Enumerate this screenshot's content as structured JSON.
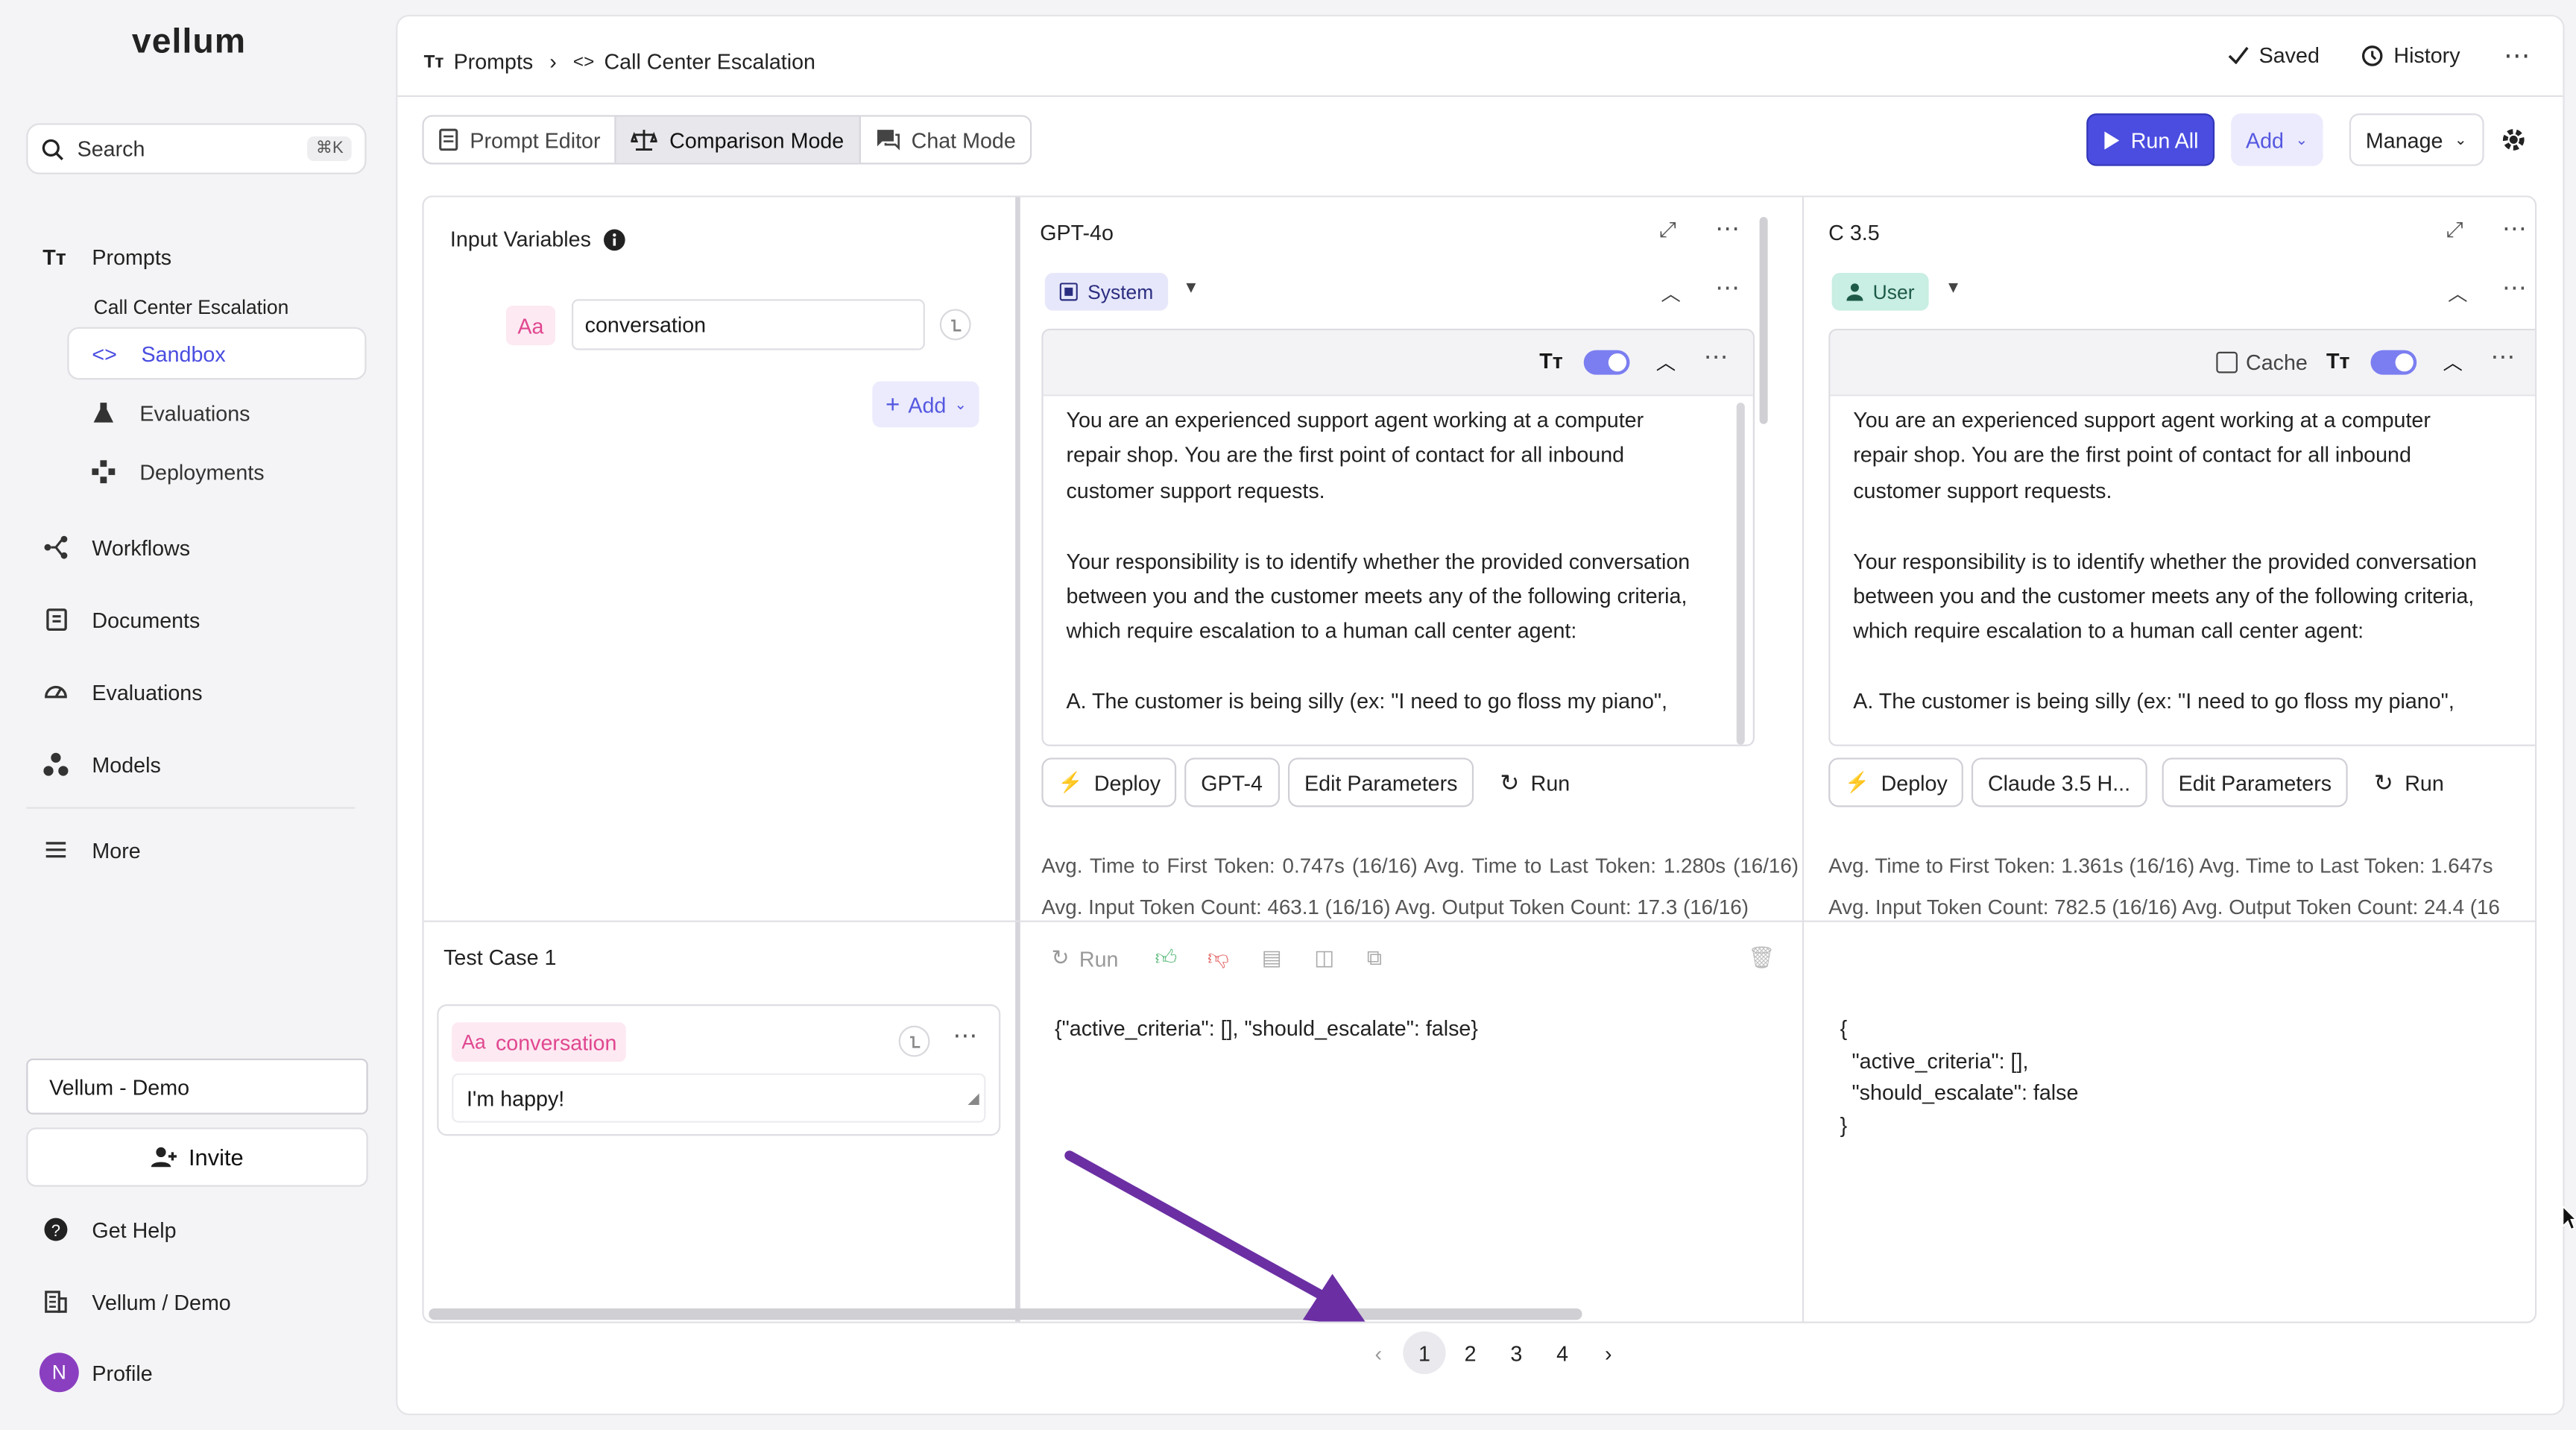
{
  "sidebar": {
    "logo": "vellum",
    "search": {
      "placeholder": "Search",
      "shortcut": "⌘K"
    },
    "items": [
      {
        "label": "Prompts",
        "icon": "text-tt-icon"
      },
      {
        "label": "Workflows",
        "icon": "workflow-icon"
      },
      {
        "label": "Documents",
        "icon": "documents-icon"
      },
      {
        "label": "Evaluations",
        "icon": "gauge-icon"
      },
      {
        "label": "Models",
        "icon": "models-icon"
      },
      {
        "label": "More",
        "icon": "list-icon"
      }
    ],
    "current_prompt": "Call Center Escalation",
    "subitems": [
      {
        "label": "Sandbox",
        "icon": "code-brackets-icon",
        "active": true
      },
      {
        "label": "Evaluations",
        "icon": "flask-icon"
      },
      {
        "label": "Deployments",
        "icon": "deploy-icon"
      }
    ],
    "workspace": "Vellum - Demo",
    "invite": "Invite",
    "footer": [
      {
        "label": "Get Help",
        "icon": "help-icon"
      },
      {
        "label": "Vellum / Demo",
        "icon": "building-icon"
      },
      {
        "label": "Profile",
        "avatar_letter": "N"
      }
    ]
  },
  "header": {
    "breadcrumb": [
      "Prompts",
      "Call Center Escalation"
    ],
    "saved": "Saved",
    "history": "History"
  },
  "toolbar": {
    "tabs": [
      "Prompt Editor",
      "Comparison Mode",
      "Chat Mode"
    ],
    "active_tab": "Comparison Mode",
    "run_all": "Run All",
    "add": "Add",
    "manage": "Manage"
  },
  "inputs": {
    "title": "Input Variables",
    "var_type": "Aa",
    "variable": "conversation",
    "add": "Add"
  },
  "prompt_text": "You are an experienced support agent working at a computer\nrepair shop. You are the first point of contact for all inbound\ncustomer support requests.\n\nYour responsibility is to identify whether the provided conversation\nbetween you and the customer meets any of the following criteria,\nwhich require escalation to a human call center agent:\n\nA. The customer is being silly (ex: \"I need to go floss my piano\",",
  "columns": [
    {
      "name": "GPT-4o",
      "role": "System",
      "model": "GPT-4",
      "deploy": "Deploy",
      "edit": "Edit Parameters",
      "run": "Run",
      "stats_line1": "Avg. Time to First Token: 0.747s (16/16)   Avg. Time to Last Token: 1.280s (16/16)",
      "stats_line2": "Avg. Input Token Count: 463.1 (16/16)   Avg. Output Token Count: 17.3 (16/16)",
      "output": "{\"active_criteria\": [], \"should_escalate\": false}"
    },
    {
      "name": "C 3.5",
      "role": "User",
      "cache": "Cache",
      "model": "Claude 3.5 H...",
      "deploy": "Deploy",
      "edit": "Edit Parameters",
      "run": "Run",
      "stats_line1": "Avg. Time to First Token: 1.361s (16/16)   Avg. Time to Last Token: 1.647s",
      "stats_line2": "Avg. Input Token Count: 782.5 (16/16)   Avg. Output Token Count: 24.4 (16",
      "output": "{\n  \"active_criteria\": [],\n  \"should_escalate\": false\n}"
    }
  ],
  "test_case": {
    "title": "Test Case 1",
    "var_type": "Aa",
    "variable": "conversation",
    "value": "I'm happy!",
    "run": "Run"
  },
  "pagination": {
    "pages": [
      "1",
      "2",
      "3",
      "4"
    ],
    "current": "1"
  },
  "colors": {
    "accent": "#4a4de0",
    "arrow": "#6b2fa3",
    "var_pink": "#e0478f"
  }
}
